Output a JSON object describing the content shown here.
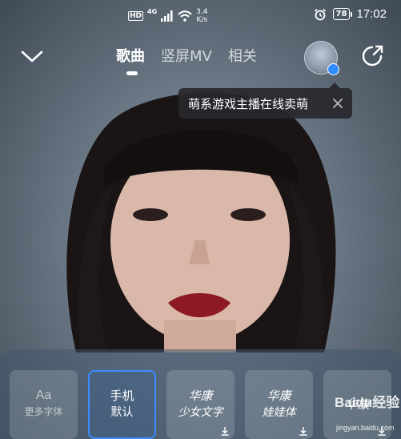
{
  "status_bar": {
    "hd": "HD",
    "network": "4G",
    "speed_value": "3.4",
    "speed_unit": "K/s",
    "battery": "78",
    "time": "17:02"
  },
  "nav": {
    "tabs": [
      {
        "label": "歌曲",
        "active": true
      },
      {
        "label": "竖屏MV",
        "active": false
      },
      {
        "label": "相关",
        "active": false
      }
    ]
  },
  "tooltip": {
    "text": "萌系游戏主播在线卖萌"
  },
  "font_panel": {
    "cards": [
      {
        "line1": "Aa",
        "line2": "更多字体",
        "selected": false,
        "download": false
      },
      {
        "line1": "手机",
        "line2": "默认",
        "selected": true,
        "download": false
      },
      {
        "line1": "华康",
        "line2": "少女文字",
        "selected": false,
        "download": true
      },
      {
        "line1": "华康",
        "line2": "娃娃体",
        "selected": false,
        "download": true
      },
      {
        "line1": "华康",
        "line2": "",
        "selected": false,
        "download": true
      }
    ]
  },
  "watermark": {
    "brand": "Baidu经验",
    "url": "jingyan.baidu.com"
  },
  "colors": {
    "accent": "#3a8cff",
    "tooltip_bg": "#28282c",
    "avatar_badge": "#2f8cff"
  }
}
